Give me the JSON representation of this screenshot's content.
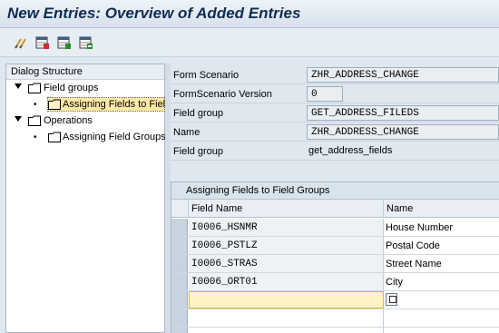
{
  "window": {
    "title": "New Entries: Overview of Added Entries"
  },
  "toolbar": {
    "buttons": [
      {
        "icon": "glasses-icon",
        "name": "display-change-button"
      },
      {
        "icon": "save-table-icon",
        "name": "new-entries-button"
      },
      {
        "icon": "copy-table-icon",
        "name": "copy-as-button"
      },
      {
        "icon": "delete-table-icon",
        "name": "delete-button"
      }
    ]
  },
  "dialog_structure": {
    "header": "Dialog Structure",
    "items": [
      {
        "label": "Field groups",
        "level": 0,
        "expanded": true
      },
      {
        "label": "Assigning Fields to Field",
        "level": 1,
        "selected": true
      },
      {
        "label": "Operations",
        "level": 0,
        "expanded": true
      },
      {
        "label": "Assigning Field Groups t",
        "level": 1,
        "selected": false
      }
    ]
  },
  "form": {
    "rows": [
      {
        "label": "Form Scenario",
        "value": "ZHR_ADDRESS_CHANGE"
      },
      {
        "label": "FormScenario Version",
        "value": "0"
      },
      {
        "label": "Field group",
        "value": "GET_ADDRESS_FILEDS"
      },
      {
        "label": "Name",
        "value": "ZHR_ADDRESS_CHANGE"
      },
      {
        "label": "Field group",
        "value": "get_address_fields"
      }
    ]
  },
  "table": {
    "title": "Assigning Fields to Field Groups",
    "columns": [
      "Field Name",
      "Name"
    ],
    "rows": [
      {
        "field_name": "I0006_HSNMR",
        "name": "House Number"
      },
      {
        "field_name": "I0006_PSTLZ",
        "name": "Postal Code"
      },
      {
        "field_name": "I0006_STRAS",
        "name": "Street Name"
      },
      {
        "field_name": "I0006_ORT01",
        "name": "City"
      },
      {
        "field_name": "",
        "name": ""
      },
      {
        "field_name": "",
        "name": ""
      },
      {
        "field_name": "",
        "name": ""
      }
    ]
  },
  "colors": {
    "title_text": "#0f2c52",
    "edit_cell": "#fff3c6",
    "selected_tree_item": "#fde9a7"
  }
}
